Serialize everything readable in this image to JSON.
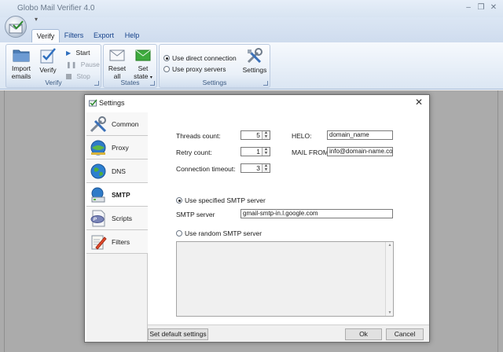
{
  "app": {
    "title": "Globo Mail Verifier 4.0"
  },
  "window_controls": {
    "minimize": "–",
    "restore": "❐",
    "close": "✕"
  },
  "ribbon": {
    "tabs": [
      {
        "label": "Verify",
        "active": true
      },
      {
        "label": "Filters",
        "active": false
      },
      {
        "label": "Export",
        "active": false
      },
      {
        "label": "Help",
        "active": false
      }
    ],
    "verify_group": {
      "label": "Verify",
      "import_line1": "Import",
      "import_line2": "emails",
      "verify": "Verify",
      "start": "Start",
      "pause": "Pause",
      "stop": "Stop"
    },
    "states_group": {
      "label": "States",
      "reset_line1": "Reset",
      "reset_line2": "all",
      "set_line1": "Set",
      "set_line2": "state"
    },
    "settings_group": {
      "label": "Settings",
      "direct": "Use direct connection",
      "proxy": "Use proxy servers",
      "settings": "Settings",
      "selected": "direct"
    }
  },
  "dialog": {
    "title": "Settings",
    "close": "✕",
    "sidebar": [
      {
        "label": "Common",
        "icon": "tools-icon"
      },
      {
        "label": "Proxy",
        "icon": "proxy-globe-icon"
      },
      {
        "label": "DNS",
        "icon": "dns-globe-icon"
      },
      {
        "label": "SMTP",
        "icon": "smtp-server-icon",
        "active": true
      },
      {
        "label": "Scripts",
        "icon": "php-script-icon"
      },
      {
        "label": "Filters",
        "icon": "filter-pencil-icon"
      }
    ],
    "smtp": {
      "threads_label": "Threads count:",
      "threads_value": "5",
      "retry_label": "Retry count:",
      "retry_value": "1",
      "timeout_label": "Connection timeout:",
      "timeout_value": "3",
      "helo_label": "HELO:",
      "helo_value": "domain_name",
      "mailfrom_label": "MAIL FROM:",
      "mailfrom_value": "info@domain-name.com",
      "use_specified_label": "Use specified SMTP server",
      "smtp_server_label": "SMTP server",
      "smtp_server_value": "gmail-smtp-in.l.google.com",
      "use_random_label": "Use random SMTP server",
      "selected": "specified"
    },
    "buttons": {
      "defaults": "Set default settings",
      "ok": "Ok",
      "cancel": "Cancel"
    }
  }
}
